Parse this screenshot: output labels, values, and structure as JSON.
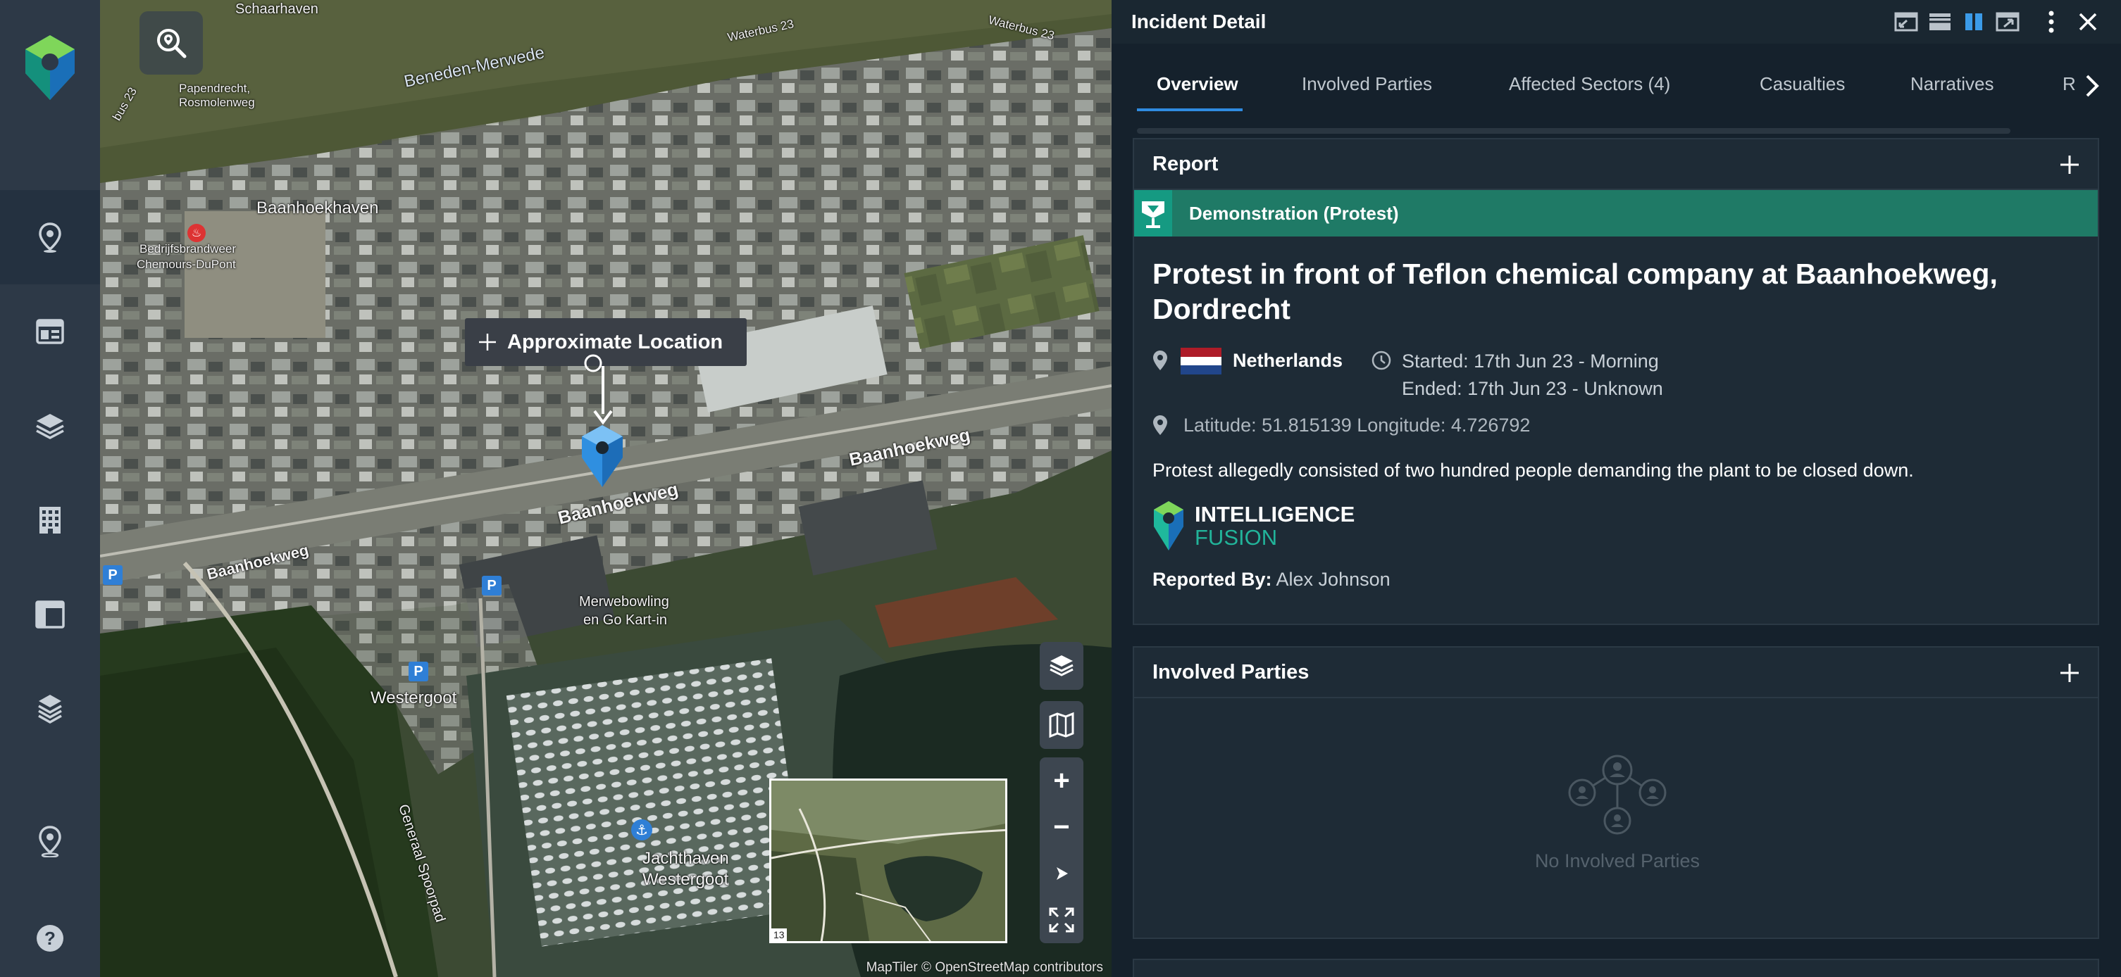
{
  "nav": {
    "items": [
      {
        "name": "nav-incidents",
        "icon": "map-pin-icon",
        "active": true
      },
      {
        "name": "nav-dashboard",
        "icon": "dashboard-icon",
        "active": false
      },
      {
        "name": "nav-layers",
        "icon": "layers-icon",
        "active": false
      },
      {
        "name": "nav-buildings",
        "icon": "building-icon",
        "active": false
      },
      {
        "name": "nav-layout",
        "icon": "layout-icon",
        "active": false
      },
      {
        "name": "nav-stack",
        "icon": "stacked-layers-icon",
        "active": false
      },
      {
        "name": "nav-location",
        "icon": "location-pin-icon",
        "active": false
      },
      {
        "name": "nav-help",
        "icon": "help-icon",
        "active": false
      }
    ]
  },
  "map": {
    "labels": {
      "schaarhaven": "Schaarhaven",
      "beneden_merwede": "Beneden-Merwede",
      "waterbus_23_a": "Waterbus 23",
      "waterbus_23_b": "Waterbus 23",
      "waterbus_23_c": "bus 23",
      "papendrecht": "Papendrecht,",
      "rosmolenweg": "Rosmolenweg",
      "baanhoekhaven": "Baanhoekhaven",
      "bedrijfsbrandweer": "Bedrijfsbrandweer",
      "chemours": "Chemours-DuPont",
      "baanhoekweg_1": "Baanhoekweg",
      "baanhoekweg_2": "Baanhoekweg",
      "baanhoekweg_3": "Baanhoekweg",
      "merwebowling_1": "Merwebowling",
      "merwebowling_2": "en Go Kart-in",
      "westergoot": "Westergoot",
      "jachthaven_1": "Jachthaven",
      "jachthaven_2": "Westergoot",
      "generaal": "Generaal Spoorpad",
      "parking": "P"
    },
    "callout": "Approximate Location",
    "attribution": "MapTiler © OpenStreetMap contributors",
    "controls": {
      "zoom_in": "+",
      "zoom_out": "−"
    },
    "minimap_number": "13"
  },
  "panel": {
    "title": "Incident Detail",
    "tabs": [
      {
        "label": "Overview",
        "active": true
      },
      {
        "label": "Involved Parties",
        "active": false
      },
      {
        "label": "Affected Sectors (4)",
        "active": false
      },
      {
        "label": "Casualties",
        "active": false
      },
      {
        "label": "Narratives",
        "active": false
      },
      {
        "label": "R",
        "active": false
      }
    ],
    "report": {
      "heading": "Report",
      "category": "Demonstration (Protest)",
      "category_color": "#1f7a66",
      "title": "Protest in front of Teflon chemical company at Baanhoekweg, Dordrecht",
      "country": "Netherlands",
      "started": "Started: 17th Jun 23 - Morning",
      "ended": "Ended: 17th Jun 23 - Unknown",
      "coordinates": "Latitude: 51.815139 Longitude: 4.726792",
      "description": "Protest allegedly consisted of two hundred people demanding the plant to be closed down.",
      "source_logo_line1": "INTELLIGENCE",
      "source_logo_line2": "FUSION",
      "reported_by_label": "Reported By:",
      "reported_by_value": "Alex Johnson"
    },
    "involved": {
      "heading": "Involved Parties",
      "empty": "No Involved Parties"
    }
  },
  "colors": {
    "accent_blue": "#2f8be0",
    "brand_teal": "#22b49a",
    "panel_bg": "#15212c",
    "card_bg": "#1e2b36",
    "rail_bg": "#2d3947"
  }
}
